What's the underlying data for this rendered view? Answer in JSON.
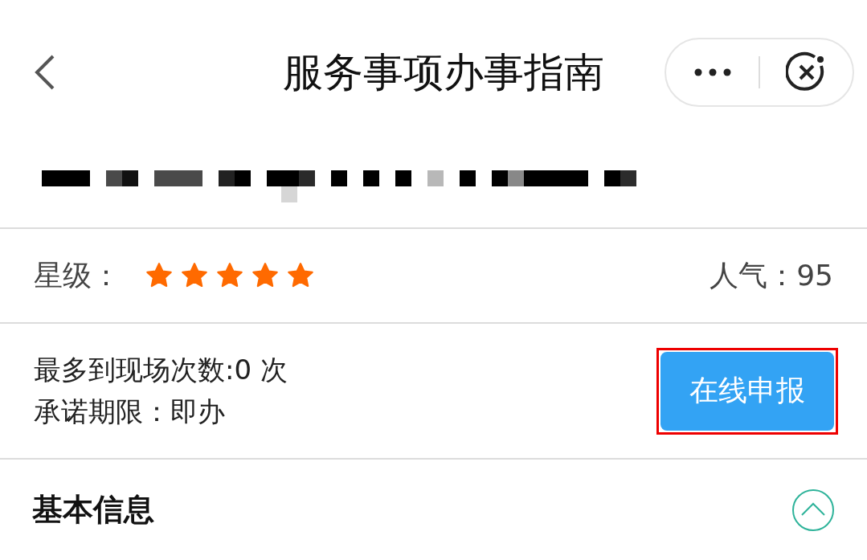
{
  "nav_bar": {
    "title": "服务事项办事指南"
  },
  "rating": {
    "label": "星级：",
    "stars": 5,
    "popularity": "人气：95"
  },
  "info": {
    "lines": [
      "最多到现场次数:0 次",
      "承诺期限：即办"
    ],
    "button": {
      "label": "在线申报",
      "highlighted": true
    }
  },
  "section": {
    "title": "基本信息",
    "expanded": true
  }
}
